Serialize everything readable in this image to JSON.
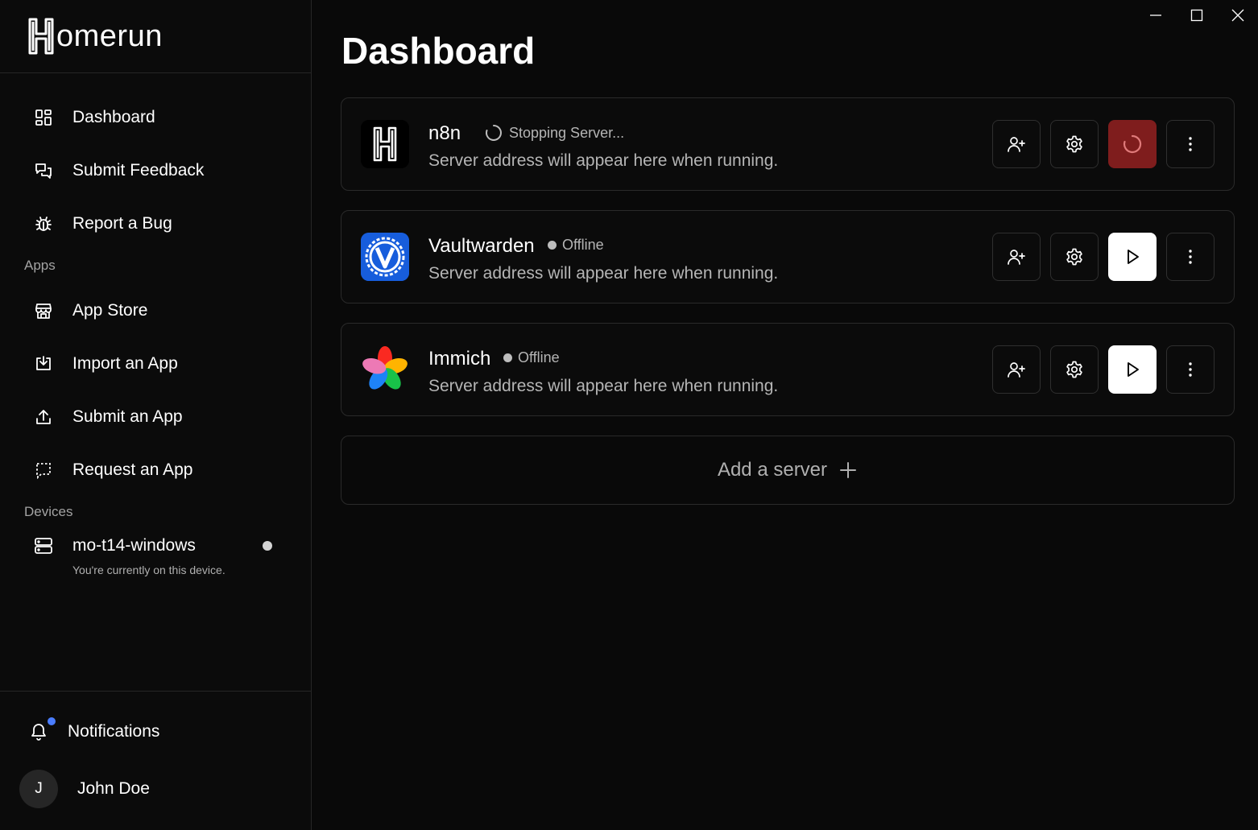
{
  "brand": {
    "name": "omerun"
  },
  "sidebar": {
    "nav": [
      {
        "label": "Dashboard",
        "icon": "dashboard-icon"
      },
      {
        "label": "Submit Feedback",
        "icon": "feedback-icon"
      },
      {
        "label": "Report a Bug",
        "icon": "bug-icon"
      }
    ],
    "apps_label": "Apps",
    "apps": [
      {
        "label": "App Store",
        "icon": "store-icon"
      },
      {
        "label": "Import an App",
        "icon": "import-icon"
      },
      {
        "label": "Submit an App",
        "icon": "upload-icon"
      },
      {
        "label": "Request an App",
        "icon": "request-icon"
      }
    ],
    "devices_label": "Devices",
    "device": {
      "name": "mo-t14-windows",
      "subtitle": "You're currently on this device."
    },
    "notifications_label": "Notifications",
    "user": {
      "initial": "J",
      "name": "John Doe"
    }
  },
  "main": {
    "title": "Dashboard",
    "servers": [
      {
        "name": "n8n",
        "status": "Stopping Server...",
        "address": "Server address will appear here when running.",
        "state": "stopping"
      },
      {
        "name": "Vaultwarden",
        "status": "Offline",
        "address": "Server address will appear here when running.",
        "state": "offline"
      },
      {
        "name": "Immich",
        "status": "Offline",
        "address": "Server address will appear here when running.",
        "state": "offline"
      }
    ],
    "add_server_label": "Add a server"
  },
  "colors": {
    "stop_button": "#7f1d1d",
    "notification_badge": "#4a7dff",
    "vaultwarden_blue": "#175ddc"
  }
}
